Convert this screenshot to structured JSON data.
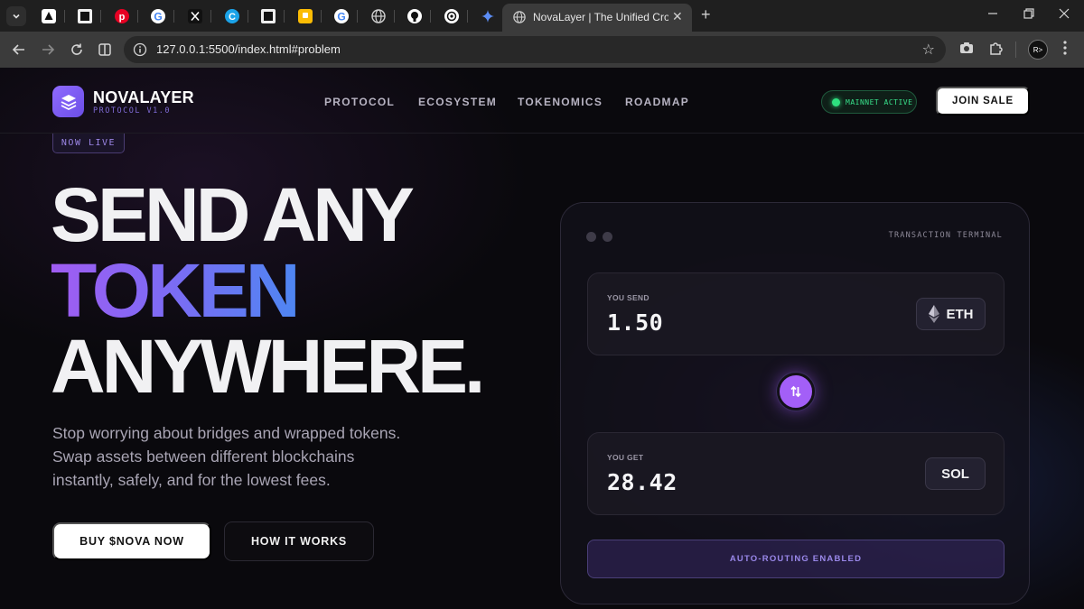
{
  "browser": {
    "active_tab": {
      "title": "NovaLayer | The Unified Cross-Chain Swap"
    },
    "new_tab_glyph": "+",
    "url": "127.0.0.1:5500/index.html#problem",
    "pinned_tab_icons": [
      "notion-icon",
      "notion-icon",
      "pinterest-icon",
      "google-icon",
      "x-icon",
      "edge-copilot-icon",
      "notion-icon",
      "keep-icon",
      "google-icon",
      "globe-icon",
      "github-icon",
      "chatgpt-icon",
      "gemini-icon"
    ],
    "window_controls": [
      "minimize",
      "restore",
      "close"
    ],
    "profile_label": "R>"
  },
  "site": {
    "logo": {
      "name": "NOVALAYER",
      "subtitle": "PROTOCOL V1.0"
    },
    "nav": [
      {
        "label": "PROTOCOL"
      },
      {
        "label": "ECOSYSTEM"
      },
      {
        "label": "TOKENOMICS"
      },
      {
        "label": "ROADMAP"
      }
    ],
    "status_badge": "MAINNET ACTIVE",
    "join_button": "JOIN SALE"
  },
  "hero": {
    "badge": "NOW LIVE",
    "line1": "SEND ANY",
    "line2": "TOKEN",
    "line3": "ANYWHERE.",
    "description": [
      "Stop worrying about bridges and wrapped tokens.",
      "Swap assets between different blockchains",
      "instantly, safely, and for the lowest fees."
    ],
    "primary_button": "BUY $NOVA NOW",
    "secondary_button": "HOW IT WORKS"
  },
  "terminal": {
    "label": "TRANSACTION TERMINAL",
    "send": {
      "label": "YOU SEND",
      "amount": "1.50",
      "token": "ETH"
    },
    "get": {
      "label": "YOU GET",
      "amount": "28.42",
      "token": "SOL"
    },
    "routing": "AUTO-ROUTING ENABLED"
  },
  "colors": {
    "accent_purple": "#a35ff7",
    "accent_blue": "#4e86f2",
    "status_green": "#2ee07f",
    "background": "#0a090d"
  }
}
